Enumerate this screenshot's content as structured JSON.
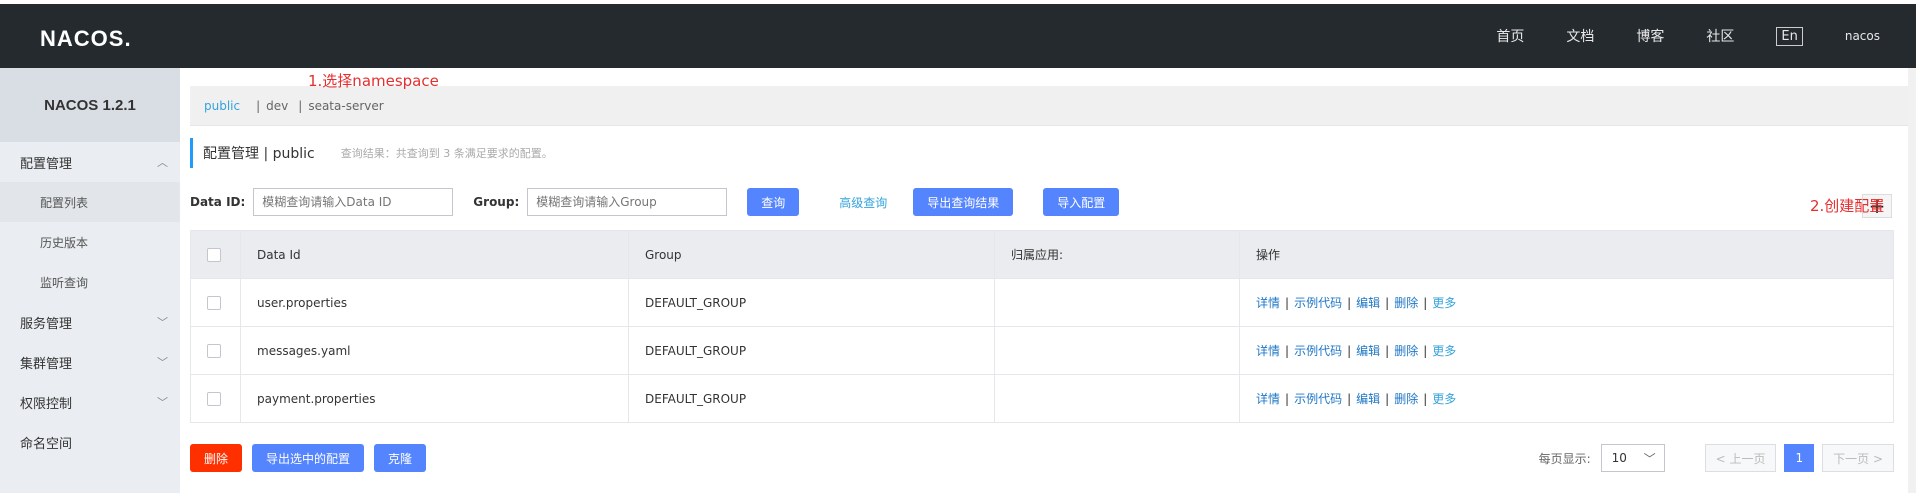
{
  "header": {
    "logo": "NACOS.",
    "nav": [
      "首页",
      "文档",
      "博客",
      "社区"
    ],
    "lang": "En",
    "user": "nacos"
  },
  "sidebar": {
    "brand": "NACOS 1.2.1",
    "items": [
      {
        "label": "配置管理",
        "chevron": "︿"
      },
      {
        "label": "配置列表"
      },
      {
        "label": "历史版本"
      },
      {
        "label": "监听查询"
      },
      {
        "label": "服务管理",
        "chevron": "﹀"
      },
      {
        "label": "集群管理",
        "chevron": "﹀"
      },
      {
        "label": "权限控制",
        "chevron": "﹀"
      },
      {
        "label": "命名空间"
      }
    ]
  },
  "namespaces": [
    "public",
    "dev",
    "seata-server"
  ],
  "annotations": {
    "select_ns": "1.选择namespace",
    "create": "2.创建配置"
  },
  "title": {
    "main": "配置管理 | public",
    "sub": "查询结果：共查询到 3 条满足要求的配置。"
  },
  "search": {
    "dataid_label": "Data ID:",
    "dataid_placeholder": "模糊查询请输入Data ID",
    "group_label": "Group:",
    "group_placeholder": "模糊查询请输入Group",
    "query": "查询",
    "advanced": "高级查询",
    "export_result": "导出查询结果",
    "import": "导入配置",
    "add": "+"
  },
  "table": {
    "headers": [
      "Data Id",
      "Group",
      "归属应用:",
      "操作"
    ],
    "rows": [
      {
        "dataId": "user.properties",
        "group": "DEFAULT_GROUP",
        "app": ""
      },
      {
        "dataId": "messages.yaml",
        "group": "DEFAULT_GROUP",
        "app": ""
      },
      {
        "dataId": "payment.properties",
        "group": "DEFAULT_GROUP",
        "app": ""
      }
    ],
    "ops": [
      "详情",
      "示例代码",
      "编辑",
      "删除"
    ],
    "more": "更多"
  },
  "footer": {
    "delete": "删除",
    "export_selected": "导出选中的配置",
    "clone": "克隆",
    "page_size_label": "每页显示:",
    "page_size": "10",
    "prev": "< 上一页",
    "page": "1",
    "next": "下一页 >"
  }
}
